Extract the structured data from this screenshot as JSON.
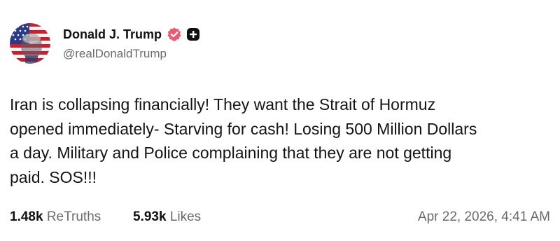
{
  "author": {
    "display_name": "Donald J. Trump",
    "handle": "@realDonaldTrump",
    "avatar_icon": "flag-portrait-avatar",
    "verified_icon": "verified-badge-icon",
    "extra_icon": "plus-square-icon",
    "verified_color": "#e85d75"
  },
  "post": {
    "text": "Iran is collapsing financially! They want the Strait of Hormuz\nopened immediately- Starving for cash! Losing 500 Million Dollars\na day. Military and Police complaining that they are not getting\npaid. SOS!!!"
  },
  "stats": {
    "retruths_count": "1.48k",
    "retruths_label": "ReTruths",
    "likes_count": "5.93k",
    "likes_label": "Likes"
  },
  "timestamp": "Apr 22, 2026, 4:41 AM"
}
